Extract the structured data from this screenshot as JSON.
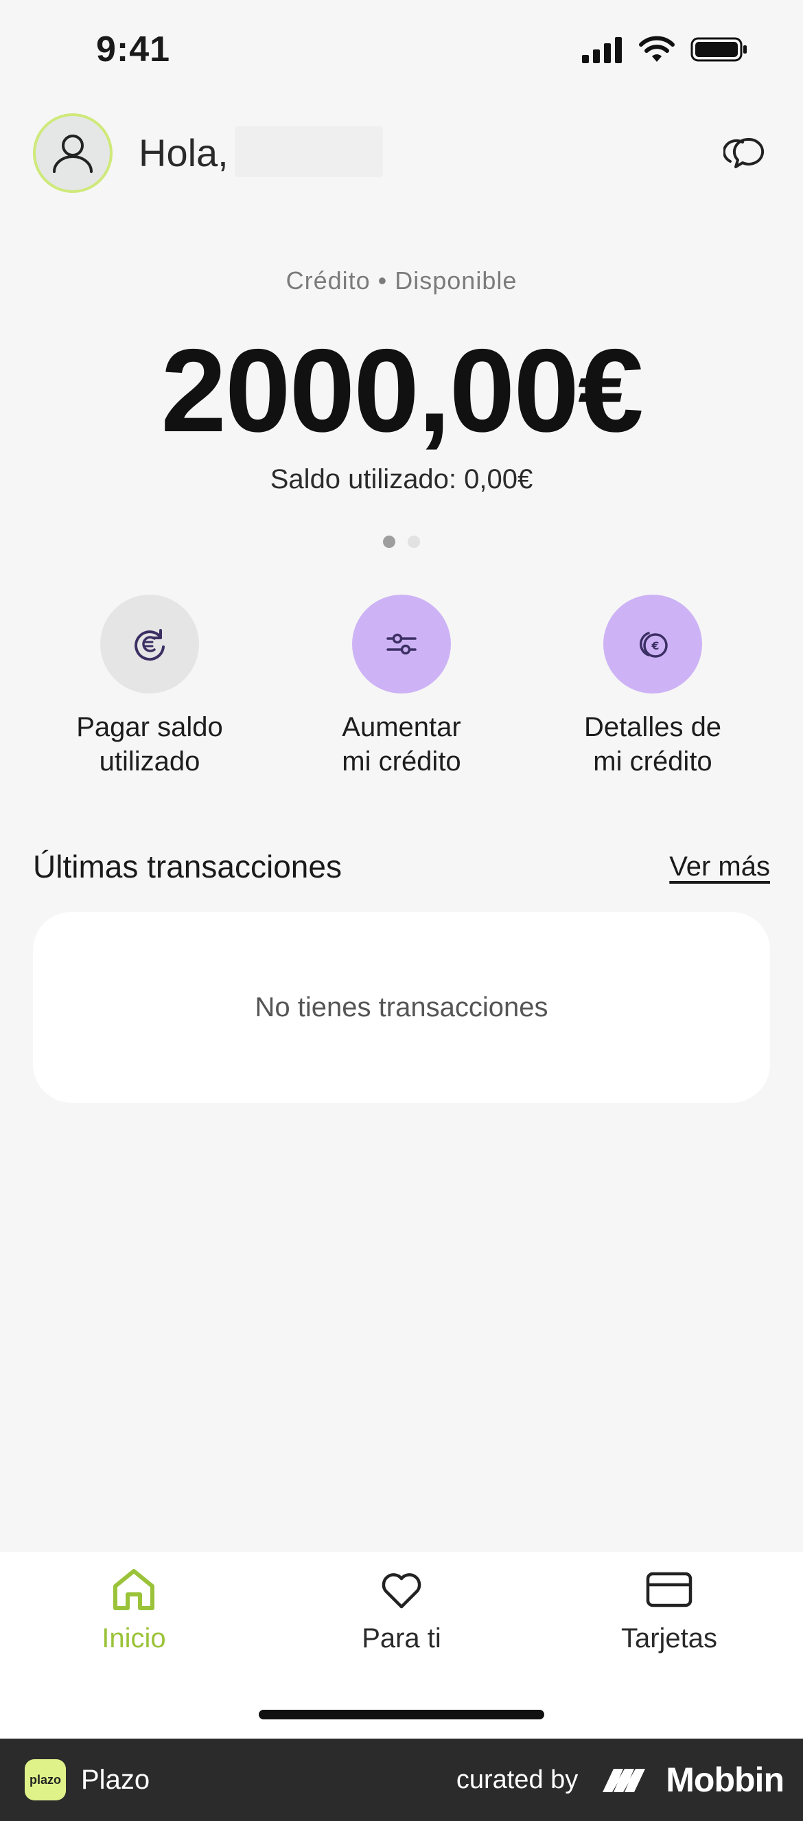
{
  "status_bar": {
    "time": "9:41"
  },
  "header": {
    "greeting": "Hola,"
  },
  "credit": {
    "label": "Crédito • Disponible",
    "amount": "2000,00€",
    "used": "Saldo utilizado: 0,00€",
    "pages": 2,
    "active_page": 1
  },
  "actions": [
    {
      "label_line1": "Pagar saldo",
      "label_line2": "utilizado",
      "icon": "euro-refresh-icon",
      "color": "#e5e5e5"
    },
    {
      "label_line1": "Aumentar",
      "label_line2": "mi crédito",
      "icon": "sliders-icon",
      "color": "#cdb3f5"
    },
    {
      "label_line1": "Detalles de",
      "label_line2": "mi crédito",
      "icon": "coins-euro-icon",
      "color": "#cdb3f5"
    }
  ],
  "transactions": {
    "title": "Últimas transacciones",
    "more": "Ver más",
    "empty": "No tienes transacciones"
  },
  "nav": [
    {
      "label": "Inicio",
      "icon": "home-icon",
      "active": true
    },
    {
      "label": "Para ti",
      "icon": "heart-icon",
      "active": false
    },
    {
      "label": "Tarjetas",
      "icon": "card-icon",
      "active": false
    }
  ],
  "footer": {
    "app_logo_text": "plazo",
    "app_name": "Plazo",
    "curated": "curated by",
    "brand": "Mobbin"
  },
  "colors": {
    "accent": "#9bc33a",
    "avatar_ring": "#cfe97a",
    "purple": "#cdb3f5"
  }
}
